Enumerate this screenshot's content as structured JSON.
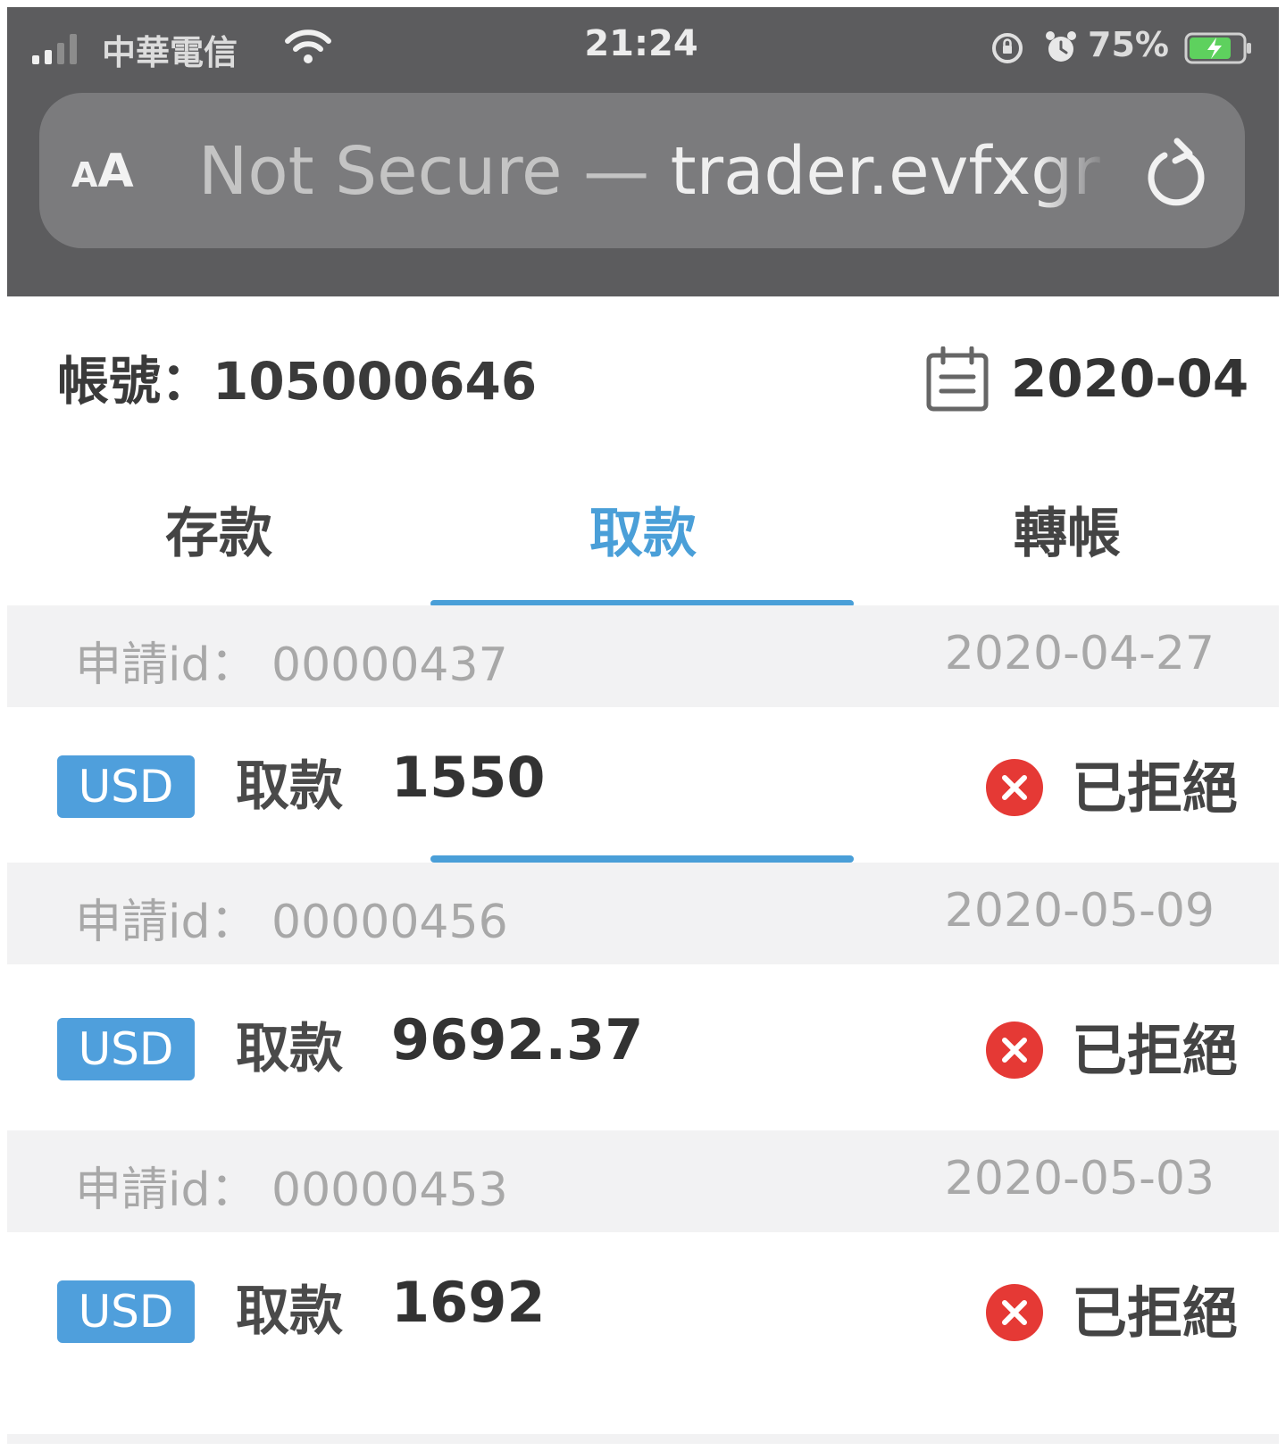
{
  "status_bar": {
    "carrier": "中華電信",
    "time": "21:24",
    "battery": "75%",
    "icons": [
      "signal-icon",
      "wifi-icon",
      "orientation-lock-icon",
      "alarm-icon",
      "battery-charging-icon"
    ]
  },
  "browser": {
    "text_size_label_small": "A",
    "text_size_label_large": "A",
    "url_security": "Not Secure —",
    "url_host": " trader.evfxgr",
    "reload_icon": "reload-icon"
  },
  "account": {
    "label": "帳號：105000646",
    "month": "2020-04",
    "calendar_icon": "calendar-icon"
  },
  "tabs": [
    {
      "label": "存款",
      "active": false
    },
    {
      "label": "取款",
      "active": true
    },
    {
      "label": "轉帳",
      "active": false
    }
  ],
  "records": [
    {
      "id_label": "申請id： 00000437",
      "date": "2020-04-27",
      "currency": "USD",
      "type": "取款",
      "amount": "1550",
      "status": "已拒絕"
    },
    {
      "id_label": "申請id： 00000456",
      "date": "2020-05-09",
      "currency": "USD",
      "type": "取款",
      "amount": "9692.37",
      "status": "已拒絕"
    },
    {
      "id_label": "申請id： 00000453",
      "date": "2020-05-03",
      "currency": "USD",
      "type": "取款",
      "amount": "1692",
      "status": "已拒絕"
    }
  ],
  "colors": {
    "accent": "#4a9fd8",
    "badge": "#4f9fdc",
    "rejected": "#e53935",
    "chrome": "#5c5c5e",
    "address_bar": "#7b7b7d"
  }
}
